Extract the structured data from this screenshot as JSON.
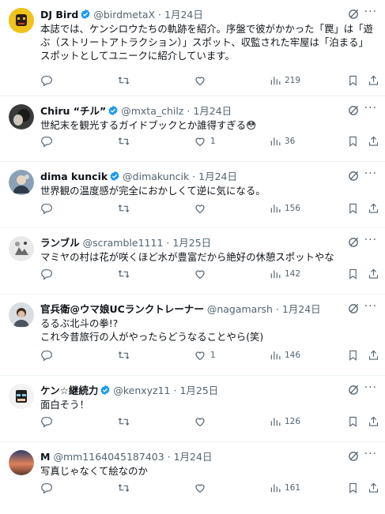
{
  "colors": {
    "verified": "#1d9bf0",
    "text": "#0f1419",
    "secondary": "#536471",
    "divider": "#eff3f4"
  },
  "icons": [
    "reply-icon",
    "retweet-icon",
    "like-icon",
    "views-icon",
    "bookmark-icon",
    "share-icon",
    "grok-icon",
    "more-icon",
    "verified-badge-icon"
  ],
  "posts": [
    {
      "name": "DJ Bird",
      "verified": true,
      "handle": "@birdmetaX",
      "date": "1月24日",
      "lines": [
        "本誌では、ケンシロウたちの軌跡を紹介。序盤で彼がかかった「罠」は「遊",
        "ぶ（ストリートアトラクション）」スポット、収監された牢屋は「泊まる」",
        "スポットとしてユニークに紹介しています。"
      ],
      "likes": "",
      "views": "219"
    },
    {
      "name": "Chiru “チル”",
      "verified": true,
      "handle": "@mxta_chilz",
      "date": "1月24日",
      "lines": [
        "世紀末を観光するガイドブックとか誰得すぎる😳"
      ],
      "likes": "1",
      "views": "36"
    },
    {
      "name": "dima kuncik",
      "verified": true,
      "handle": "@dimakuncik",
      "date": "1月24日",
      "lines": [
        "世界観の温度感が完全におかしくて逆に気になる。"
      ],
      "likes": "",
      "views": "156"
    },
    {
      "name": "ランブル",
      "verified": false,
      "handle": "@scramble1111",
      "date": "1月25日",
      "lines": [
        "マミヤの村は花が咲くほど水が豊富だから絶好の休憩スポットやな"
      ],
      "likes": "",
      "views": "142"
    },
    {
      "name": "官兵衛@ウマ娘UCランクトレーナー",
      "verified": false,
      "handle": "@nagamarsh",
      "date": "1月24日",
      "lines": [
        "るるぶ北斗の拳!?",
        "これ今昔旅行の人がやったらどうなることやら(笑)"
      ],
      "likes": "1",
      "views": "146"
    },
    {
      "name": "ケン☆継続力",
      "verified": true,
      "handle": "@kenxyz11",
      "date": "1月25日",
      "lines": [
        "面白そう！"
      ],
      "likes": "",
      "views": "126"
    },
    {
      "name": "M",
      "verified": false,
      "handle": "@mm1164045187403",
      "date": "1月24日",
      "lines": [
        "写真じゃなくて絵なのか"
      ],
      "likes": "",
      "views": "161"
    }
  ]
}
